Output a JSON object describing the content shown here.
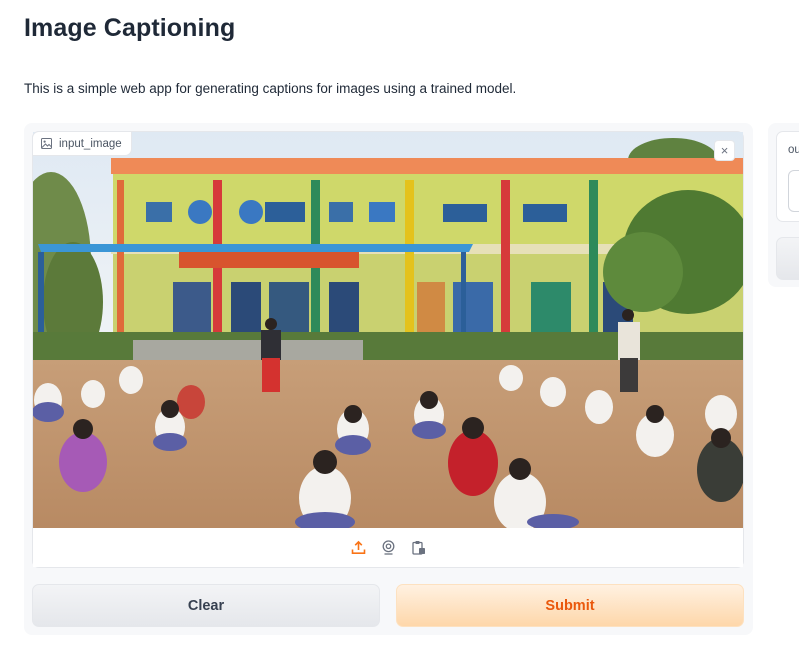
{
  "page": {
    "title": "Image Captioning",
    "description": "This is a simple web app for generating captions for images using a trained model."
  },
  "input_image": {
    "label": "input_image",
    "label_icon": "image-icon",
    "clear_icon": "close-icon",
    "clear_symbol": "×",
    "toolbar_icons": [
      "upload-icon",
      "webcam-icon",
      "clipboard-icon"
    ]
  },
  "actions": {
    "clear_label": "Clear",
    "submit_label": "Submit"
  },
  "output": {
    "label": "output"
  },
  "colors": {
    "accent": "#ea580c",
    "submit_bg": "#fed7aa",
    "clear_bg": "#e5e7eb",
    "panel_bg": "#f7f8fa"
  }
}
